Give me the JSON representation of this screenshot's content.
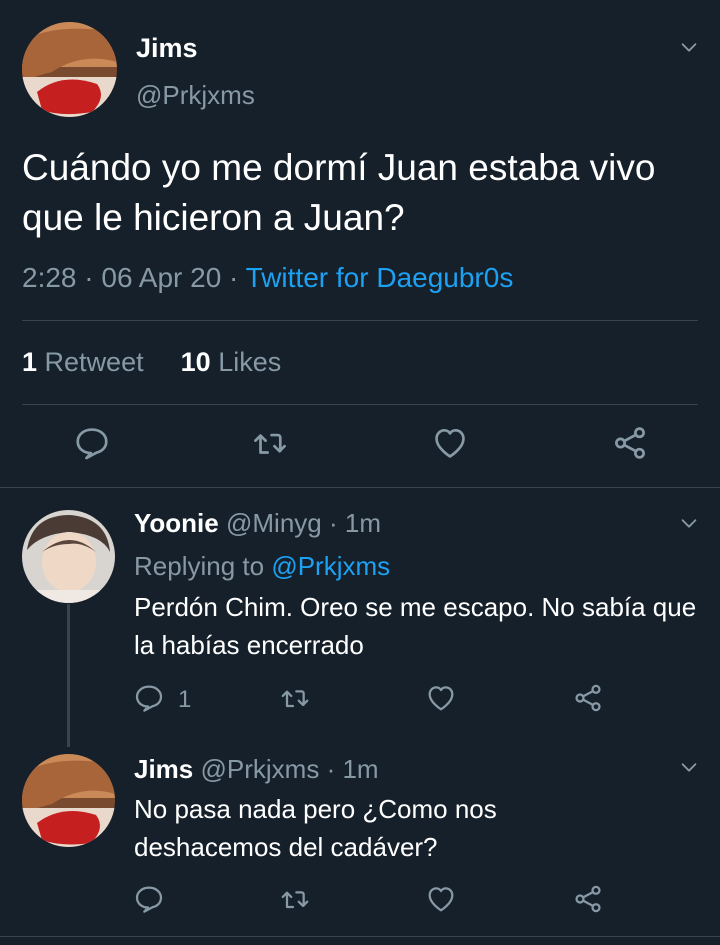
{
  "main": {
    "name": "Jims",
    "handle": "@Prkjxms",
    "text": "Cuándo yo me dormí Juan estaba vivo que le hicieron a Juan?",
    "time": "2:28",
    "date": "06 Apr 20",
    "source": "Twitter for Daegubr0s",
    "retweets": "1",
    "retweets_label": "Retweet",
    "likes": "10",
    "likes_label": "Likes"
  },
  "replies": [
    {
      "name": "Yoonie",
      "handle": "@Minyg",
      "time": "1m",
      "replying_label": "Replying to",
      "replying_to": "@Prkjxms",
      "text": "Perdón Chim. Oreo se me escapo. No sabía que la habías encerrado",
      "reply_count": "1"
    },
    {
      "name": "Jims",
      "handle": "@Prkjxms",
      "time": "1m",
      "text": "No pasa nada pero ¿Como nos deshacemos del cadáver?"
    }
  ],
  "separator": "·",
  "colors": {
    "background": "#15202b",
    "text": "#ffffff",
    "secondary": "#8899a6",
    "accent": "#1da1f2",
    "divider": "#38444d"
  }
}
